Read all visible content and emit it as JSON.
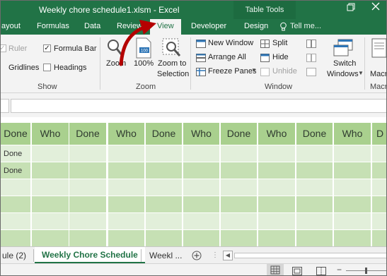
{
  "window": {
    "title": "Weekly chore schedule1.xlsm - Excel",
    "context_tab": "Table Tools",
    "restore_icon": "restore-window-icon"
  },
  "ribbon_tabs": [
    {
      "label": "ayout"
    },
    {
      "label": "Formulas"
    },
    {
      "label": "Data"
    },
    {
      "label": "Review"
    },
    {
      "label": "View"
    },
    {
      "label": "Developer"
    },
    {
      "label": "Design"
    }
  ],
  "tell_me": "Tell me...",
  "ribbon": {
    "show": {
      "ruler": "Ruler",
      "formula_bar": "Formula Bar",
      "gridlines": "Gridlines",
      "headings": "Headings",
      "label": "Show"
    },
    "zoom": {
      "zoom": "Zoom",
      "hundred": "100%",
      "hundred_icon_text": "100",
      "zoom_to": "Zoom to",
      "selection": "Selection",
      "label": "Zoom"
    },
    "window": {
      "new_window": "New Window",
      "arrange_all": "Arrange All",
      "freeze_panes": "Freeze Panes",
      "split": "Split",
      "hide": "Hide",
      "unhide": "Unhide",
      "switch": "Switch",
      "windows": "Windows",
      "label": "Window"
    },
    "macros": {
      "line1": "Macr",
      "label": "Macr"
    }
  },
  "grid": {
    "headers": [
      "Done",
      "Who",
      "Done",
      "Who",
      "Done",
      "Who",
      "Done",
      "Who",
      "Done",
      "Who",
      "D"
    ],
    "rows": [
      [
        "Done"
      ],
      [
        "Done"
      ],
      [
        ""
      ],
      [
        ""
      ],
      [
        ""
      ],
      [
        ""
      ]
    ],
    "colors": {
      "header": "#a9d08e",
      "row_light": "#e2efda",
      "row_mid": "#c6e0b4"
    }
  },
  "sheets": {
    "prev": "ule (2)",
    "active": "Weekly Chore Schedule",
    "next": "Weekl ...",
    "add_icon": "plus-circle-icon"
  },
  "accent": "#217346",
  "annotation_color": "#c00000"
}
